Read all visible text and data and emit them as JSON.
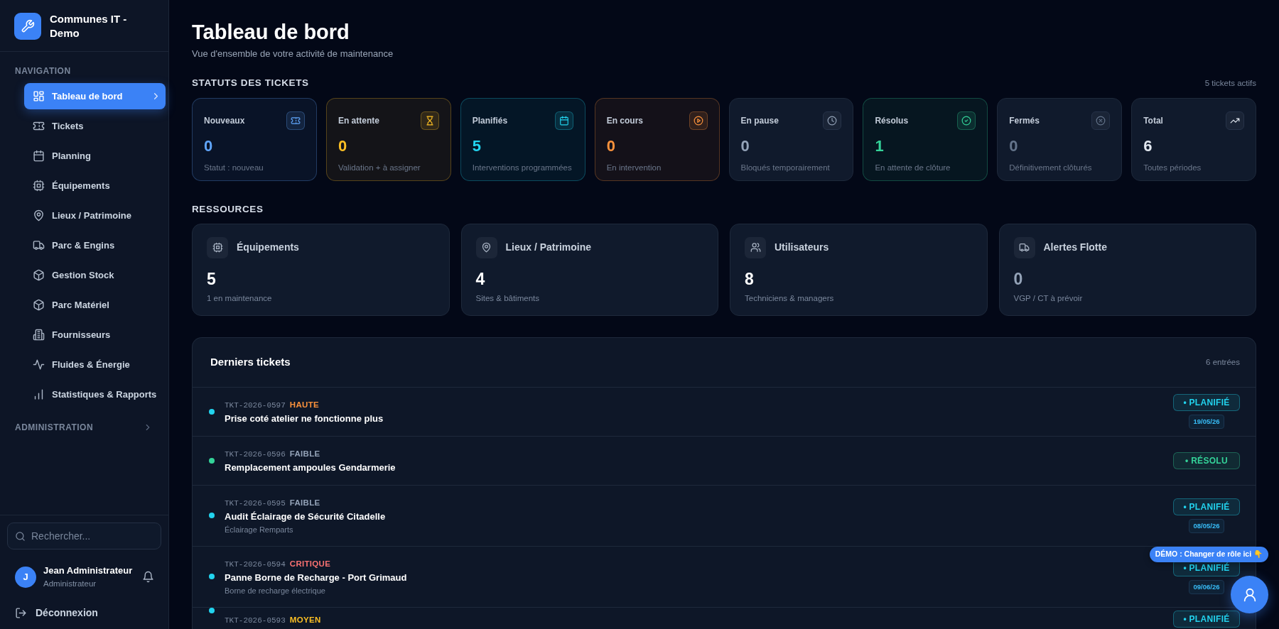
{
  "sidebar": {
    "brand": "Communes IT - Demo",
    "section": "NAVIGATION",
    "items": [
      {
        "label": "Tableau de bord",
        "selected": true
      },
      {
        "label": "Tickets",
        "selected": false
      },
      {
        "label": "Planning",
        "selected": false
      },
      {
        "label": "Équipements",
        "selected": false
      },
      {
        "label": "Lieux / Patrimoine",
        "selected": false
      },
      {
        "label": "Parc & Engins",
        "selected": false
      },
      {
        "label": "Gestion Stock",
        "selected": false
      },
      {
        "label": "Parc Matériel",
        "selected": false
      },
      {
        "label": "Fournisseurs",
        "selected": false
      },
      {
        "label": "Fluides & Énergie",
        "selected": false
      },
      {
        "label": "Statistiques & Rapports",
        "selected": false
      }
    ],
    "admin_section": {
      "label": "ADMINISTRATION",
      "expanded": false
    },
    "search": {
      "placeholder": "Rechercher..."
    },
    "user": {
      "initial": "J",
      "name": "Jean Administrateur",
      "role": "Administrateur"
    },
    "logout": "Déconnexion"
  },
  "header": {
    "title": "Tableau de bord",
    "subtitle": "Vue d'ensemble de votre activité de maintenance"
  },
  "ticket_statuses": {
    "heading": "STATUTS DES TICKETS",
    "count": "5 tickets actifs",
    "cards": [
      {
        "label": "Nouveaux",
        "value": "0",
        "note": "Statut : nouveau",
        "color": "#60a5fa",
        "tinted": true
      },
      {
        "label": "En attente",
        "value": "0",
        "note": "Validation + à assigner",
        "color": "#fbbf24",
        "tinted": true
      },
      {
        "label": "Planifiés",
        "value": "5",
        "note": "Interventions programmées",
        "color": "#22d3ee",
        "tinted": true
      },
      {
        "label": "En cours",
        "value": "0",
        "note": "En intervention",
        "color": "#fb923c",
        "tinted": true
      },
      {
        "label": "En pause",
        "value": "0",
        "note": "Bloqués temporairement",
        "color": "#94a3b8",
        "tinted": false
      },
      {
        "label": "Résolus",
        "value": "1",
        "note": "En attente de clôture",
        "color": "#34d399",
        "tinted": true
      },
      {
        "label": "Fermés",
        "value": "0",
        "note": "Définitivement clôturés",
        "color": "#64748b",
        "tinted": false
      },
      {
        "label": "Total",
        "value": "6",
        "note": "Toutes périodes",
        "color": "#e2e8f0",
        "tinted": false
      }
    ]
  },
  "resources": {
    "heading": "RESSOURCES",
    "cards": [
      {
        "label": "Équipements",
        "value": "5",
        "note": "1 en maintenance",
        "color": "#ffffff"
      },
      {
        "label": "Lieux / Patrimoine",
        "value": "4",
        "note": "Sites & bâtiments",
        "color": "#ffffff"
      },
      {
        "label": "Utilisateurs",
        "value": "8",
        "note": "Techniciens & managers",
        "color": "#ffffff"
      },
      {
        "label": "Alertes Flotte",
        "value": "0",
        "note": "VGP / CT à prévoir",
        "color": "#94a3b8"
      }
    ]
  },
  "latest_tickets": {
    "title": "Derniers tickets",
    "count": "6 entrées",
    "rows": [
      {
        "ref": "TKT-2026-0597",
        "priority": {
          "text": "HAUTE",
          "color": "#fb923c"
        },
        "title": "Prise coté atelier ne fonctionne plus",
        "status": {
          "text": "• PLANIFIÉ",
          "color": "#22d3ee"
        },
        "date": "19/05/26"
      },
      {
        "ref": "TKT-2026-0596",
        "priority": {
          "text": "FAIBLE",
          "color": "#94a3b8"
        },
        "title": "Remplacement ampoules Gendarmerie",
        "status": {
          "text": "• RÉSOLU",
          "color": "#34d399"
        }
      },
      {
        "ref": "TKT-2026-0595",
        "priority": {
          "text": "FAIBLE",
          "color": "#94a3b8"
        },
        "title": "Audit Éclairage de Sécurité Citadelle",
        "location": "Éclairage Remparts",
        "status": {
          "text": "• PLANIFIÉ",
          "color": "#22d3ee"
        },
        "date": "08/05/26"
      },
      {
        "ref": "TKT-2026-0594",
        "priority": {
          "text": "CRITIQUE",
          "color": "#f87171"
        },
        "title": "Panne Borne de Recharge - Port Grimaud",
        "location": "Borne de recharge électrique",
        "status": {
          "text": "• PLANIFIÉ",
          "color": "#22d3ee"
        },
        "date": "09/06/26"
      },
      {
        "ref": "TKT-2026-0593",
        "priority": {
          "text": "MOYEN",
          "color": "#fbbf24"
        },
        "status": {
          "text": "• PLANIFIÉ",
          "color": "#22d3ee"
        }
      }
    ]
  },
  "demo_tooltip": "DÉMO : Changer de rôle ici 👇"
}
